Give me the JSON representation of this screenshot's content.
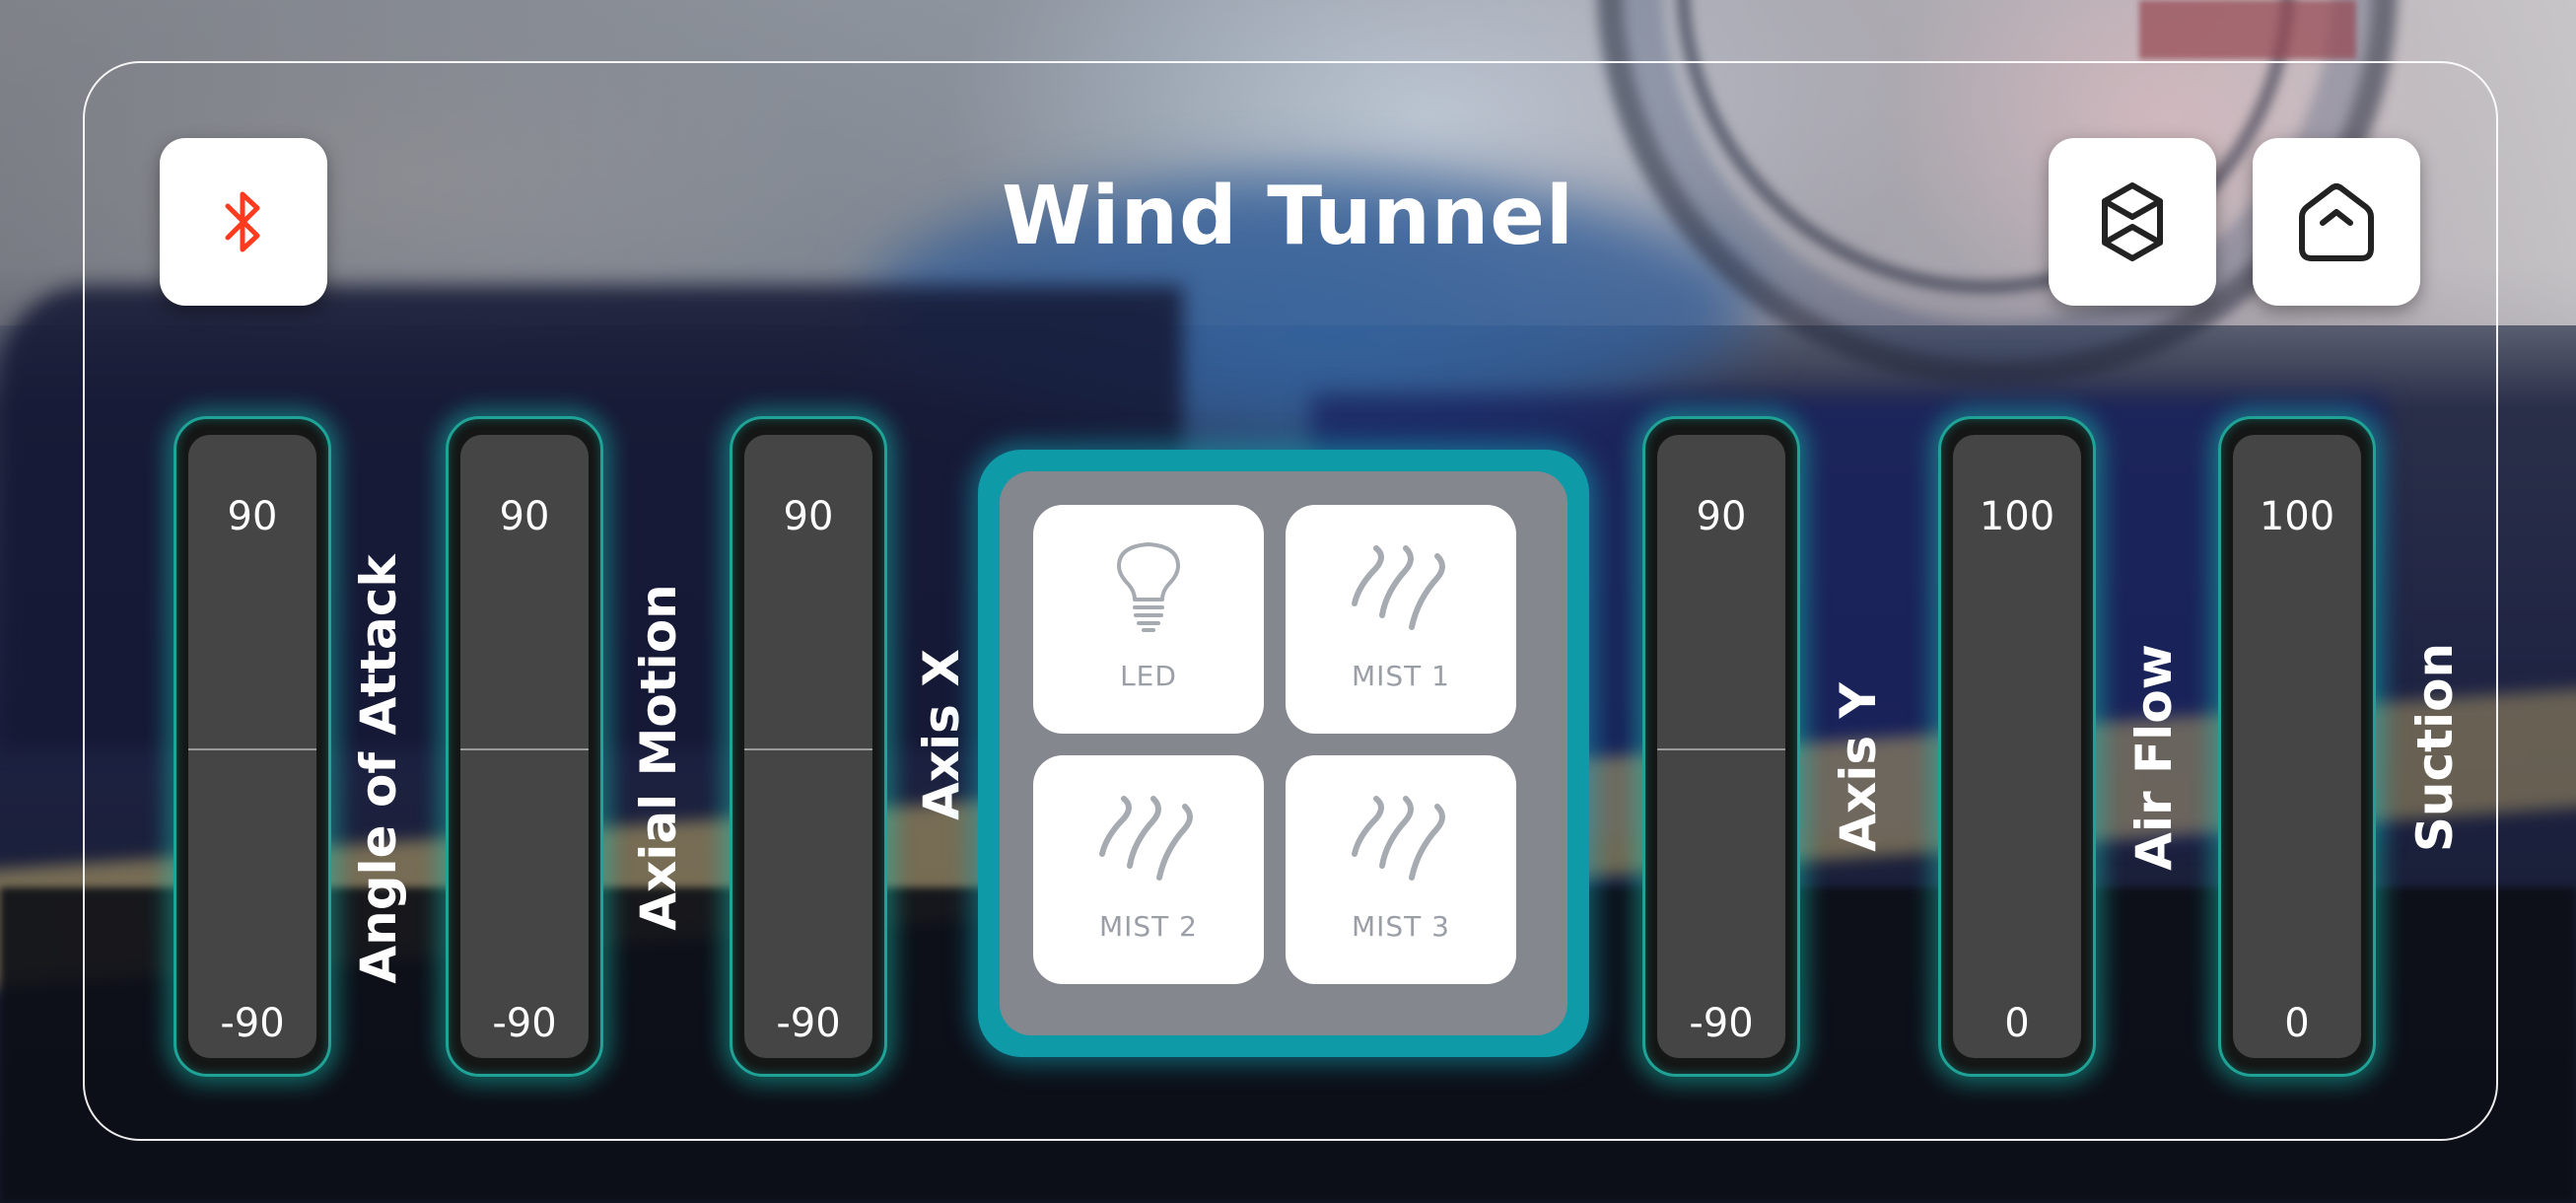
{
  "header": {
    "title": "Wind Tunnel"
  },
  "icons": {
    "bluetooth": "bluetooth-icon",
    "shortcuts": "shortcuts-icon",
    "home": "home-icon"
  },
  "colors": {
    "accent_glow": "#1fb8a8",
    "bluetooth": "#ff3b1f",
    "tile_text": "#9a9ea6"
  },
  "sliders": [
    {
      "label": "Angle of Attack",
      "max": "90",
      "min": "-90",
      "value": 0
    },
    {
      "label": "Axial Motion",
      "max": "90",
      "min": "-90",
      "value": 0
    },
    {
      "label": "Axis X",
      "max": "90",
      "min": "-90",
      "value": 0
    },
    {
      "label": "Axis Y",
      "max": "90",
      "min": "-90",
      "value": 0
    },
    {
      "label": "Air Flow",
      "max": "100",
      "min": "0",
      "value": 0
    },
    {
      "label": "Suction",
      "max": "100",
      "min": "0",
      "value": 0
    }
  ],
  "controls": [
    {
      "label": "LED",
      "icon": "lightbulb-icon"
    },
    {
      "label": "MIST 1",
      "icon": "mist-icon"
    },
    {
      "label": "MIST 2",
      "icon": "mist-icon"
    },
    {
      "label": "MIST 3",
      "icon": "mist-icon"
    }
  ]
}
